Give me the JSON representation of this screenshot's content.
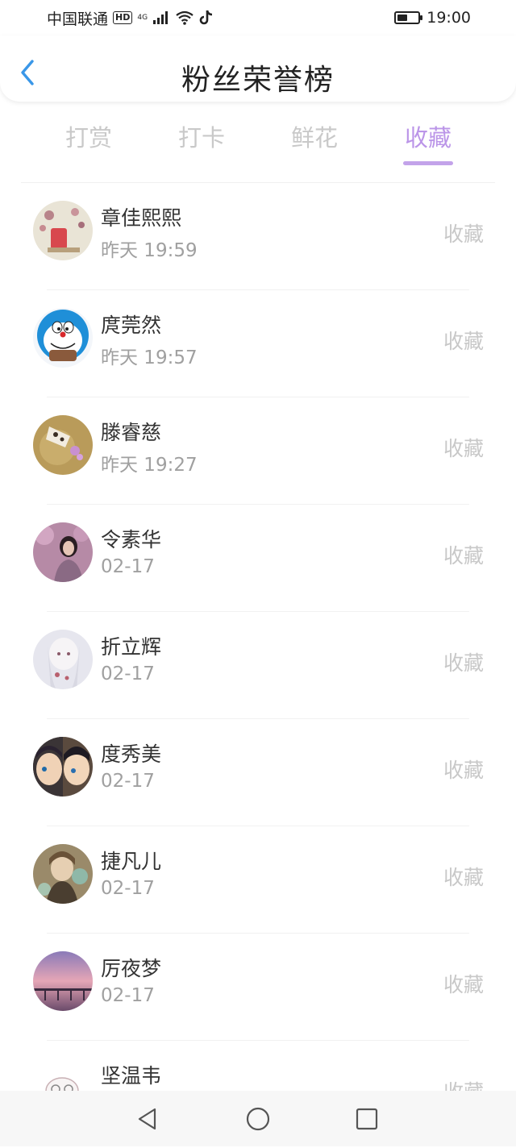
{
  "status": {
    "carrier": "中国联通",
    "hd": "HD",
    "network": "4G",
    "time": "19:00",
    "battery_level": 0.5
  },
  "header": {
    "title": "粉丝荣誉榜",
    "back_icon": "chevron-left-icon"
  },
  "tabs": [
    {
      "label": "打赏",
      "active": false
    },
    {
      "label": "打卡",
      "active": false
    },
    {
      "label": "鲜花",
      "active": false
    },
    {
      "label": "收藏",
      "active": true
    }
  ],
  "list": [
    {
      "name": "章佳熙熙",
      "time": "昨天 19:59",
      "action": "收藏"
    },
    {
      "name": "庹莞然",
      "time": "昨天 19:57",
      "action": "收藏"
    },
    {
      "name": "滕睿慈",
      "time": "昨天 19:27",
      "action": "收藏"
    },
    {
      "name": "令素华",
      "time": "02-17",
      "action": "收藏"
    },
    {
      "name": "折立辉",
      "time": "02-17",
      "action": "收藏"
    },
    {
      "name": "度秀美",
      "time": "02-17",
      "action": "收藏"
    },
    {
      "name": "捷凡儿",
      "time": "02-17",
      "action": "收藏"
    },
    {
      "name": "厉夜梦",
      "time": "02-17",
      "action": "收藏"
    },
    {
      "name": "坚温韦",
      "time": "",
      "action": "收藏"
    }
  ],
  "colors": {
    "accent": "#bb95e8",
    "inactive_tab": "#c9c9c9"
  }
}
